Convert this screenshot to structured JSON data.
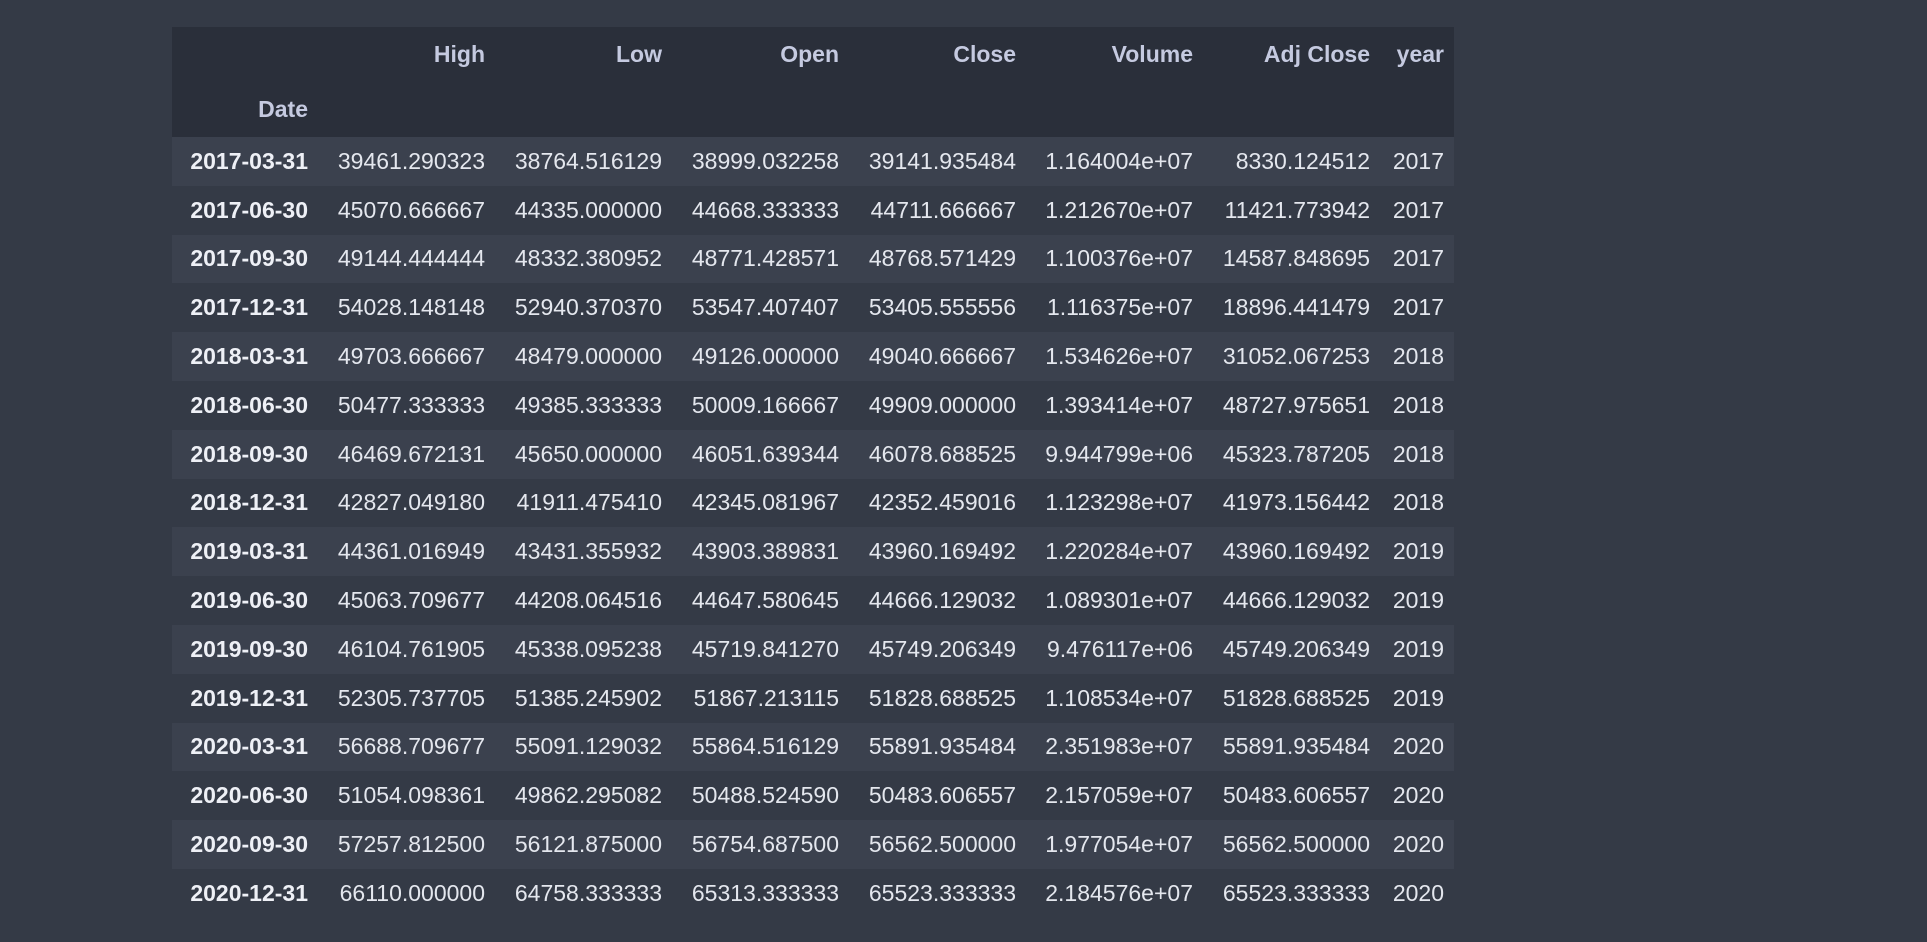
{
  "table": {
    "index_name": "Date",
    "columns": [
      "High",
      "Low",
      "Open",
      "Close",
      "Volume",
      "Adj Close",
      "year"
    ],
    "rows": [
      {
        "index": "2017-03-31",
        "values": [
          "39461.290323",
          "38764.516129",
          "38999.032258",
          "39141.935484",
          "1.164004e+07",
          "8330.124512",
          "2017"
        ]
      },
      {
        "index": "2017-06-30",
        "values": [
          "45070.666667",
          "44335.000000",
          "44668.333333",
          "44711.666667",
          "1.212670e+07",
          "11421.773942",
          "2017"
        ]
      },
      {
        "index": "2017-09-30",
        "values": [
          "49144.444444",
          "48332.380952",
          "48771.428571",
          "48768.571429",
          "1.100376e+07",
          "14587.848695",
          "2017"
        ]
      },
      {
        "index": "2017-12-31",
        "values": [
          "54028.148148",
          "52940.370370",
          "53547.407407",
          "53405.555556",
          "1.116375e+07",
          "18896.441479",
          "2017"
        ]
      },
      {
        "index": "2018-03-31",
        "values": [
          "49703.666667",
          "48479.000000",
          "49126.000000",
          "49040.666667",
          "1.534626e+07",
          "31052.067253",
          "2018"
        ]
      },
      {
        "index": "2018-06-30",
        "values": [
          "50477.333333",
          "49385.333333",
          "50009.166667",
          "49909.000000",
          "1.393414e+07",
          "48727.975651",
          "2018"
        ]
      },
      {
        "index": "2018-09-30",
        "values": [
          "46469.672131",
          "45650.000000",
          "46051.639344",
          "46078.688525",
          "9.944799e+06",
          "45323.787205",
          "2018"
        ]
      },
      {
        "index": "2018-12-31",
        "values": [
          "42827.049180",
          "41911.475410",
          "42345.081967",
          "42352.459016",
          "1.123298e+07",
          "41973.156442",
          "2018"
        ]
      },
      {
        "index": "2019-03-31",
        "values": [
          "44361.016949",
          "43431.355932",
          "43903.389831",
          "43960.169492",
          "1.220284e+07",
          "43960.169492",
          "2019"
        ]
      },
      {
        "index": "2019-06-30",
        "values": [
          "45063.709677",
          "44208.064516",
          "44647.580645",
          "44666.129032",
          "1.089301e+07",
          "44666.129032",
          "2019"
        ]
      },
      {
        "index": "2019-09-30",
        "values": [
          "46104.761905",
          "45338.095238",
          "45719.841270",
          "45749.206349",
          "9.476117e+06",
          "45749.206349",
          "2019"
        ]
      },
      {
        "index": "2019-12-31",
        "values": [
          "52305.737705",
          "51385.245902",
          "51867.213115",
          "51828.688525",
          "1.108534e+07",
          "51828.688525",
          "2019"
        ]
      },
      {
        "index": "2020-03-31",
        "values": [
          "56688.709677",
          "55091.129032",
          "55864.516129",
          "55891.935484",
          "2.351983e+07",
          "55891.935484",
          "2020"
        ]
      },
      {
        "index": "2020-06-30",
        "values": [
          "51054.098361",
          "49862.295082",
          "50488.524590",
          "50483.606557",
          "2.157059e+07",
          "50483.606557",
          "2020"
        ]
      },
      {
        "index": "2020-09-30",
        "values": [
          "57257.812500",
          "56121.875000",
          "56754.687500",
          "56562.500000",
          "1.977054e+07",
          "56562.500000",
          "2020"
        ]
      },
      {
        "index": "2020-12-31",
        "values": [
          "66110.000000",
          "64758.333333",
          "65313.333333",
          "65523.333333",
          "2.184576e+07",
          "65523.333333",
          "2020"
        ]
      }
    ]
  }
}
